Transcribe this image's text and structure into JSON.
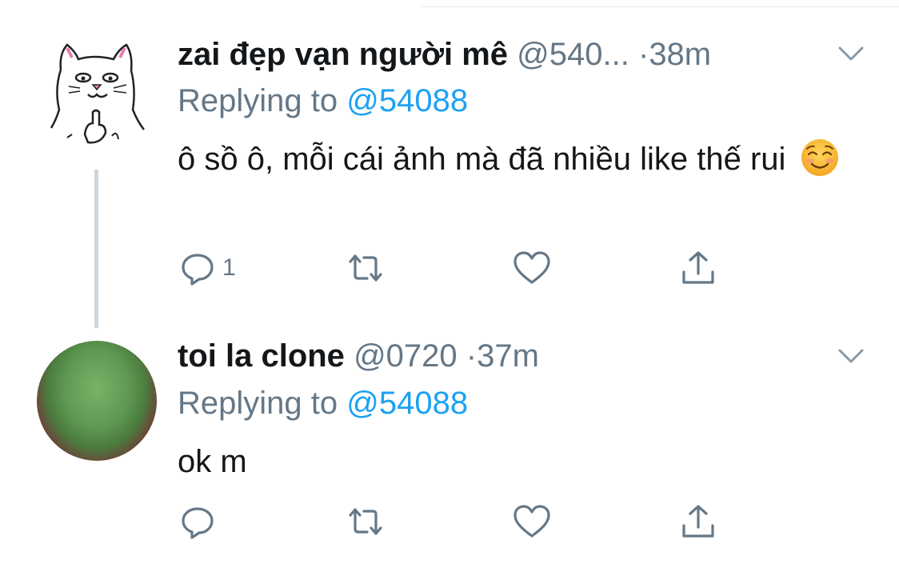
{
  "tweets": [
    {
      "name": "zai đẹp vạn người mê",
      "handle": "@540...",
      "separator": "·",
      "time": "38m",
      "replying_label": "Replying to",
      "replying_to": "@54088",
      "text": "ô sồ ô, mỗi cái ảnh mà đã nhiều like thế rui",
      "emoji": "smiling-face-emoji",
      "reply_count": "1"
    },
    {
      "name": "toi la clone",
      "handle": "@0720",
      "separator": "·",
      "time": "37m",
      "replying_label": "Replying to",
      "replying_to": "@54088",
      "text": "ok m"
    }
  ],
  "colors": {
    "link": "#1da1f2",
    "secondary_text": "#657786",
    "thread_line": "#ccd6dd"
  }
}
